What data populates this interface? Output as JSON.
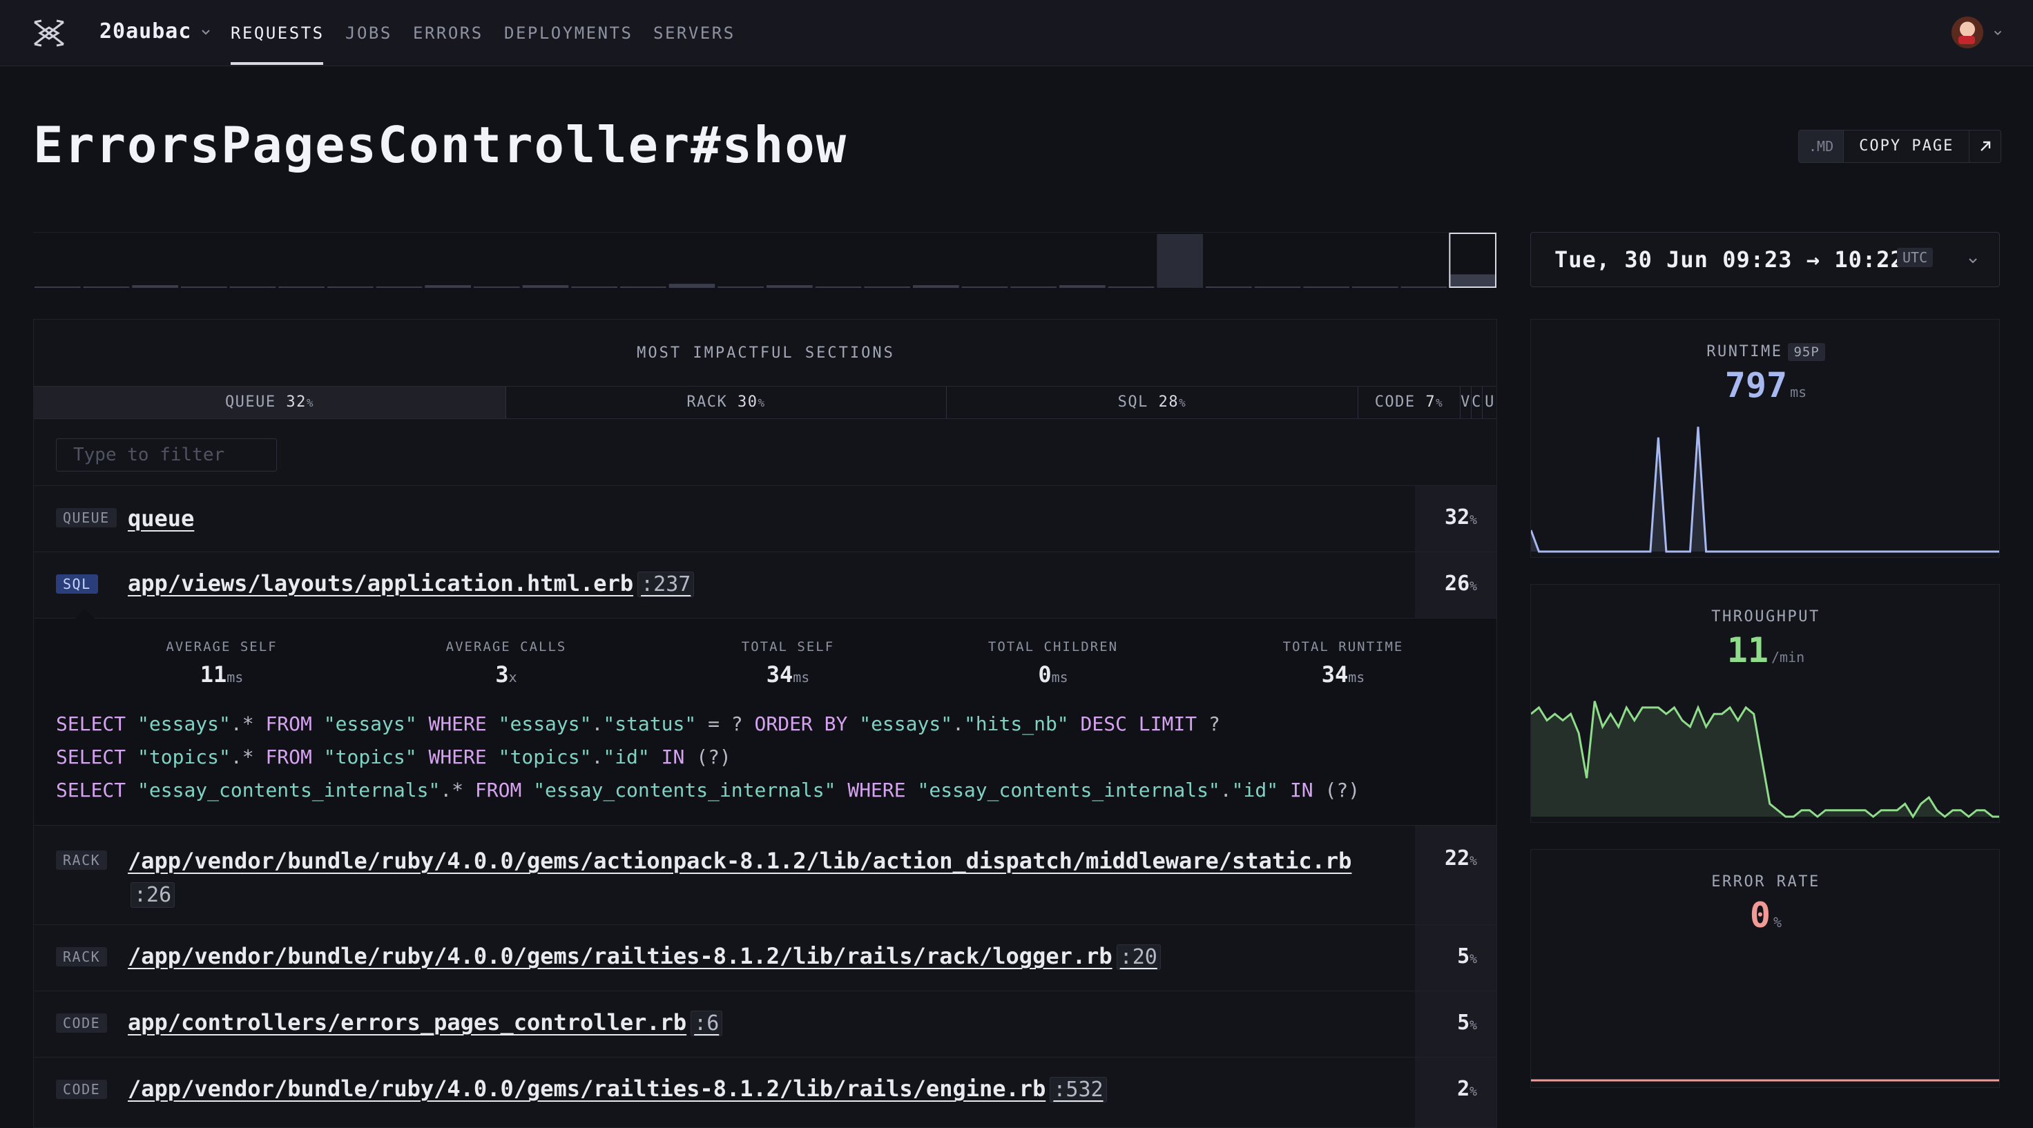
{
  "nav": {
    "app_name": "20aubac",
    "tabs": [
      "REQUESTS",
      "JOBS",
      "ERRORS",
      "DEPLOYMENTS",
      "SERVERS"
    ],
    "active_tab": "REQUESTS"
  },
  "page": {
    "title": "ErrorsPagesController#show",
    "md_label": ".MD",
    "copy_label": "COPY PAGE"
  },
  "date_range": {
    "text": "Tue, 30 Jun 09:23 → 10:22",
    "tz": "UTC"
  },
  "histogram": {
    "type": "bar",
    "values": [
      1,
      1,
      2,
      1,
      1,
      1,
      1,
      1,
      2,
      1,
      2,
      1,
      1,
      3,
      1,
      2,
      1,
      1,
      2,
      1,
      1,
      2,
      1,
      40,
      1,
      1,
      1,
      1,
      1,
      10
    ],
    "selected_index": 23,
    "ylim": [
      0,
      40
    ]
  },
  "sections": {
    "title": "MOST IMPACTFUL SECTIONS",
    "bar": [
      {
        "name": "QUEUE",
        "pct": 32
      },
      {
        "name": "RACK",
        "pct": 30
      },
      {
        "name": "SQL",
        "pct": 28
      },
      {
        "name": "CODE",
        "pct": 7
      },
      {
        "name": "V",
        "pct": 1
      },
      {
        "name": "C",
        "pct": 1
      },
      {
        "name": "U",
        "pct": 1
      }
    ],
    "filter_placeholder": "Type to filter",
    "rows": [
      {
        "tag": "QUEUE",
        "path": "queue",
        "line": "",
        "pct": "32"
      },
      {
        "tag": "SQL",
        "path": "app/views/layouts/application.html.erb",
        "line": ":237",
        "pct": "26"
      },
      {
        "tag": "RACK",
        "path": "/app/vendor/bundle/ruby/4.0.0/gems/actionpack-8.1.2/lib/action_dispatch/middleware/static.rb",
        "line": ":26",
        "pct": "22"
      },
      {
        "tag": "RACK",
        "path": "/app/vendor/bundle/ruby/4.0.0/gems/railties-8.1.2/lib/rails/rack/logger.rb",
        "line": ":20",
        "pct": "5"
      },
      {
        "tag": "CODE",
        "path": "app/controllers/errors_pages_controller.rb",
        "line": ":6",
        "pct": "5"
      },
      {
        "tag": "CODE",
        "path": "/app/vendor/bundle/ruby/4.0.0/gems/railties-8.1.2/lib/rails/engine.rb",
        "line": ":532",
        "pct": "2"
      }
    ],
    "pct_unit": "%"
  },
  "detail": {
    "stats": [
      {
        "label": "AVERAGE SELF",
        "value": "11",
        "unit": "ms"
      },
      {
        "label": "AVERAGE CALLS",
        "value": "3",
        "unit": "x"
      },
      {
        "label": "TOTAL SELF",
        "value": "34",
        "unit": "ms"
      },
      {
        "label": "TOTAL CHILDREN",
        "value": "0",
        "unit": "ms"
      },
      {
        "label": "TOTAL RUNTIME",
        "value": "34",
        "unit": "ms"
      }
    ],
    "queries": [
      [
        [
          "kw",
          "SELECT "
        ],
        [
          "str",
          "\"essays\""
        ],
        [
          "op",
          ".* "
        ],
        [
          "kw",
          "FROM "
        ],
        [
          "str",
          "\"essays\" "
        ],
        [
          "kw",
          "WHERE "
        ],
        [
          "str",
          "\"essays\""
        ],
        [
          "op",
          "."
        ],
        [
          "str",
          "\"status\" "
        ],
        [
          "op",
          "= ? "
        ],
        [
          "kw",
          "ORDER BY "
        ],
        [
          "str",
          "\"essays\""
        ],
        [
          "op",
          "."
        ],
        [
          "str",
          "\"hits_nb\" "
        ],
        [
          "kw",
          "DESC LIMIT "
        ],
        [
          "op",
          "?"
        ]
      ],
      [
        [
          "kw",
          "SELECT "
        ],
        [
          "str",
          "\"topics\""
        ],
        [
          "op",
          ".* "
        ],
        [
          "kw",
          "FROM "
        ],
        [
          "str",
          "\"topics\" "
        ],
        [
          "kw",
          "WHERE "
        ],
        [
          "str",
          "\"topics\""
        ],
        [
          "op",
          "."
        ],
        [
          "str",
          "\"id\" "
        ],
        [
          "kw",
          "IN "
        ],
        [
          "op",
          "(?)"
        ]
      ],
      [
        [
          "kw",
          "SELECT "
        ],
        [
          "str",
          "\"essay_contents_internals\""
        ],
        [
          "op",
          ".* "
        ],
        [
          "kw",
          "FROM "
        ],
        [
          "str",
          "\"essay_contents_internals\" "
        ],
        [
          "kw",
          "WHERE "
        ],
        [
          "str",
          "\"essay_contents_internals\""
        ],
        [
          "op",
          "."
        ],
        [
          "str",
          "\"id\" "
        ],
        [
          "kw",
          "IN "
        ],
        [
          "op",
          "(?)"
        ]
      ]
    ]
  },
  "cards": {
    "runtime": {
      "label": "RUNTIME",
      "badge": "95P",
      "value": "797",
      "unit": "ms",
      "color": "#a8b9f2",
      "chart_data": {
        "type": "line",
        "values": [
          30,
          0,
          0,
          0,
          0,
          0,
          0,
          0,
          0,
          0,
          0,
          0,
          0,
          0,
          0,
          0,
          160,
          0,
          0,
          0,
          0,
          175,
          0,
          0,
          0,
          0,
          0,
          0,
          0,
          0,
          0,
          0,
          0,
          0,
          0,
          0,
          0,
          0,
          0,
          0,
          0,
          0,
          0,
          0,
          0,
          0,
          0,
          0,
          0,
          0,
          0,
          0,
          0,
          0,
          0,
          0,
          0,
          0,
          0,
          0
        ],
        "ylim": [
          0,
          180
        ]
      }
    },
    "throughput": {
      "label": "THROUGHPUT",
      "value": "11",
      "unit": "/min",
      "color": "#8fdc8a",
      "chart_data": {
        "type": "area",
        "values": [
          16,
          17,
          15,
          16,
          15,
          16,
          13,
          6,
          18,
          14,
          16,
          14,
          17,
          15,
          17,
          17,
          17,
          16,
          17,
          15,
          14,
          17,
          14,
          16,
          16,
          17,
          15,
          17,
          16,
          9,
          2,
          1,
          0,
          0,
          1,
          1,
          0,
          1,
          1,
          1,
          1,
          1,
          1,
          0,
          1,
          1,
          1,
          2,
          0,
          2,
          3,
          1,
          0,
          1,
          1,
          0,
          1,
          1,
          0,
          0
        ],
        "ylim": [
          0,
          20
        ]
      }
    },
    "error_rate": {
      "label": "ERROR RATE",
      "value": "0",
      "unit": "%",
      "color": "#f29a96",
      "chart_data": {
        "type": "line",
        "values": [
          0,
          0,
          0,
          0,
          0,
          0,
          0,
          0,
          0,
          0
        ],
        "ylim": [
          0,
          1
        ]
      }
    }
  }
}
